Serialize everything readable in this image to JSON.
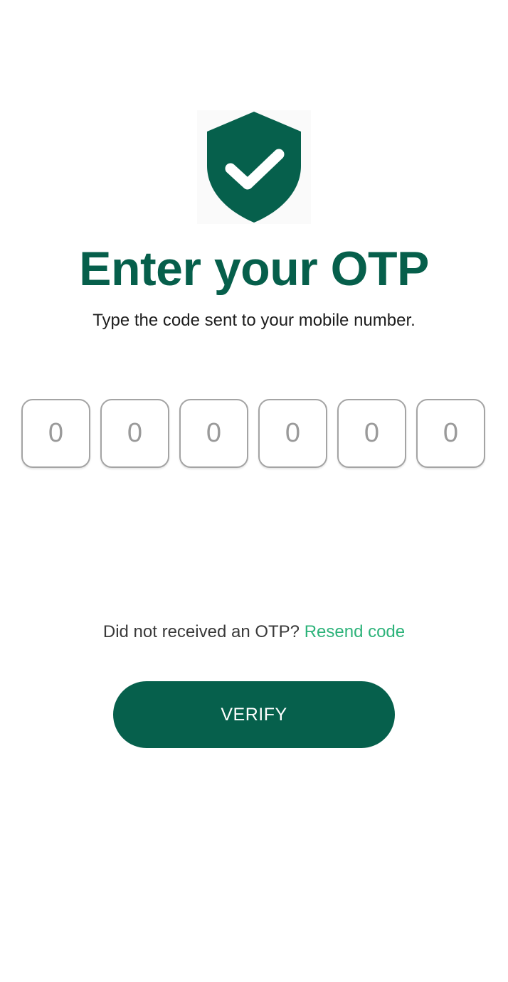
{
  "header": {
    "icon": "shield-check-icon",
    "title": "Enter your OTP",
    "subtitle": "Type the code sent to your mobile number."
  },
  "otp": {
    "digits": [
      {
        "value": "",
        "placeholder": "0"
      },
      {
        "value": "",
        "placeholder": "0"
      },
      {
        "value": "",
        "placeholder": "0"
      },
      {
        "value": "",
        "placeholder": "0"
      },
      {
        "value": "",
        "placeholder": "0"
      },
      {
        "value": "",
        "placeholder": "0"
      }
    ]
  },
  "resend": {
    "prompt": "Did not received an OTP? ",
    "link_label": "Resend code"
  },
  "verify_button": {
    "label": "VERIFY"
  },
  "colors": {
    "primary": "#06604c",
    "link": "#2db37a",
    "text": "#1d1d1d",
    "box_border": "#a4a4a4"
  }
}
